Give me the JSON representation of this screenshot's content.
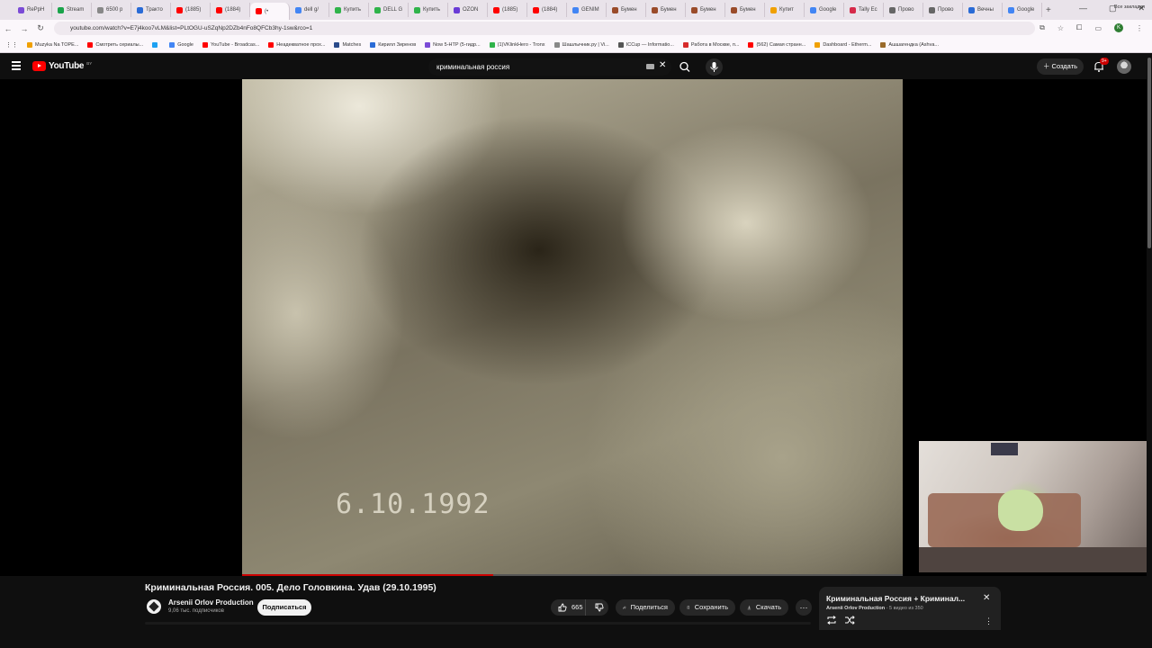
{
  "browser": {
    "tabs": [
      {
        "label": "RePpH",
        "color": "#7b4bd6"
      },
      {
        "label": "Stream",
        "color": "#1aa34a"
      },
      {
        "label": "6500 р",
        "color": "#888888"
      },
      {
        "label": "Трактo",
        "color": "#2a6bd6"
      },
      {
        "label": "(1885)",
        "color": "#ff0000"
      },
      {
        "label": "(1884)",
        "color": "#ff0000"
      },
      {
        "label": "(•",
        "color": "#ff0000",
        "active": true
      },
      {
        "label": "dell g/",
        "color": "#4285f4"
      },
      {
        "label": "Купить",
        "color": "#2fb34a"
      },
      {
        "label": "DELL G",
        "color": "#2fb34a"
      },
      {
        "label": "Купить",
        "color": "#2fb34a"
      },
      {
        "label": "OZON",
        "color": "#6a3bd6"
      },
      {
        "label": "(1885)",
        "color": "#ff0000"
      },
      {
        "label": "(1884)",
        "color": "#ff0000"
      },
      {
        "label": "GENIM",
        "color": "#4285f4"
      },
      {
        "label": "Бумен",
        "color": "#9a4b2a"
      },
      {
        "label": "Бумен",
        "color": "#9a4b2a"
      },
      {
        "label": "Бумен",
        "color": "#9a4b2a"
      },
      {
        "label": "Бумен",
        "color": "#9a4b2a"
      },
      {
        "label": "Купит",
        "color": "#f0a000"
      },
      {
        "label": "Google",
        "color": "#4285f4"
      },
      {
        "label": "Tally Ес",
        "color": "#d62a4a"
      },
      {
        "label": "Прово",
        "color": "#666666"
      },
      {
        "label": "Прово",
        "color": "#666666"
      },
      {
        "label": "Вечны",
        "color": "#2a6bd6"
      },
      {
        "label": "Google",
        "color": "#4285f4"
      }
    ],
    "url": "youtube.com/watch?v=E7j4koo7vLM&list=PLtOGU-uSZqNp2DZb4nFo8QFCb3hy-1sw&rco=1",
    "bookmarks": [
      {
        "label": "Muzyka Na TOPE...",
        "color": "#f0a000"
      },
      {
        "label": "Смотреть сериалы...",
        "color": "#ff0000"
      },
      {
        "label": "",
        "color": "#1da1f2"
      },
      {
        "label": "Google",
        "color": "#4285f4"
      },
      {
        "label": "YouTube - Broadcas...",
        "color": "#ff0000"
      },
      {
        "label": "Неадекватное прох...",
        "color": "#ff0000"
      },
      {
        "label": "Matches",
        "color": "#2a4a8a"
      },
      {
        "label": "Кирилл Зиренов",
        "color": "#2a6bd6"
      },
      {
        "label": "Now 5-HTP (5-гидр...",
        "color": "#7b4bd6"
      },
      {
        "label": "(1)VKlinkHero - Tronx",
        "color": "#2fb34a"
      },
      {
        "label": "Шашлычник.ру | Vi...",
        "color": "#888888"
      },
      {
        "label": "ICCup — Informatio...",
        "color": "#555555"
      },
      {
        "label": "Работа в Москве, п...",
        "color": "#d62a2a"
      },
      {
        "label": "(562) Самая странн...",
        "color": "#ff0000"
      },
      {
        "label": "Dashboard - Etherm...",
        "color": "#f0a000"
      },
      {
        "label": "Ашшагендка (Ashva...",
        "color": "#9a6a2a"
      }
    ],
    "bookmarks_all": "Все закладки"
  },
  "youtube": {
    "logo_text": "YouTube",
    "logo_region": "BY",
    "search_query": "криминальная россия",
    "create_label": "Создать",
    "notif_badge": "9+"
  },
  "video": {
    "overlay_date": "6.10.1992",
    "progress_fraction": 0.38,
    "title": "Криминальная Россия. 005. Дело Головкина. Удав (29.10.1995)",
    "channel_name": "Arsenii Orlov Production",
    "channel_subs": "9,06 тыс. подписчиков",
    "subscribe_label": "Подписаться",
    "likes": "665",
    "share_label": "Поделиться",
    "save_label": "Сохранить",
    "download_label": "Скачать"
  },
  "playlist": {
    "title": "Криминальная Россия + Криминал...",
    "owner": "Arsenii Orlov Production",
    "position": "- 5 видео из 350"
  }
}
